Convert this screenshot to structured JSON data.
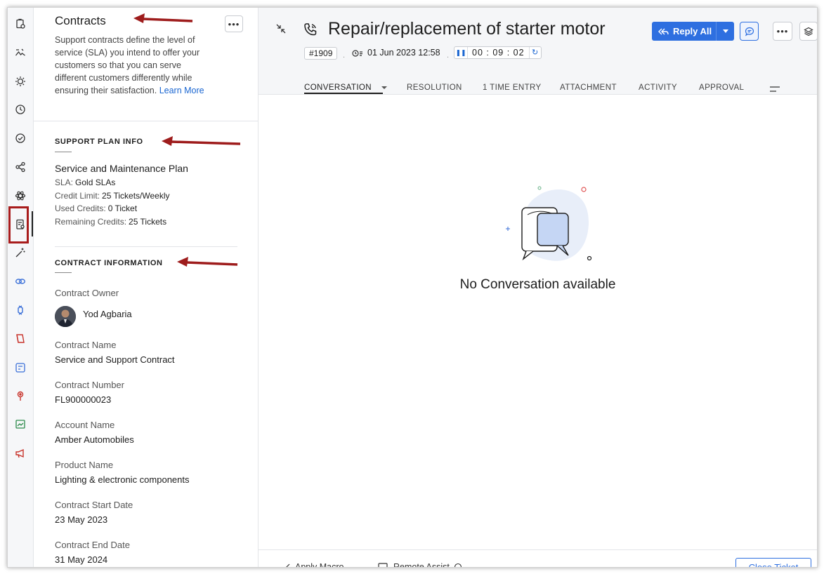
{
  "panel": {
    "title": "Contracts",
    "more_label": "•••",
    "description": "Support contracts define the level of service (SLA) you intend to offer your customers so that you can serve different customers differently while ensuring their satisfaction.",
    "learn_more": "Learn More",
    "support_plan": {
      "heading": "SUPPORT PLAN INFO",
      "plan_name": "Service and Maintenance Plan",
      "sla_label": "SLA:",
      "sla_value": "Gold SLAs",
      "credit_limit_label": "Credit Limit:",
      "credit_limit_value": "25 Tickets/Weekly",
      "used_credits_label": "Used Credits:",
      "used_credits_value": "0 Ticket",
      "remaining_credits_label": "Remaining Credits:",
      "remaining_credits_value": "25 Tickets"
    },
    "contract_info": {
      "heading": "CONTRACT INFORMATION",
      "owner_label": "Contract Owner",
      "owner_name": "Yod Agbaria",
      "name_label": "Contract Name",
      "name_value": "Service and Support Contract",
      "number_label": "Contract Number",
      "number_value": "FL900000023",
      "account_label": "Account Name",
      "account_value": "Amber Automobiles",
      "product_label": "Product Name",
      "product_value": "Lighting & electronic components",
      "start_label": "Contract Start Date",
      "start_value": "23 May 2023",
      "end_label": "Contract End Date",
      "end_value": "31 May 2024"
    }
  },
  "ticket": {
    "title": "Repair/replacement of starter motor",
    "id": "#1909",
    "separator": ".",
    "due_date": "01 Jun 2023 12:58",
    "timer": "00 : 09 : 02",
    "reply_all": "Reply All",
    "more_label": "•••"
  },
  "tabs": [
    {
      "label": "CONVERSATION"
    },
    {
      "label": "RESOLUTION"
    },
    {
      "label": "1 TIME ENTRY"
    },
    {
      "label": "ATTACHMENT"
    },
    {
      "label": "ACTIVITY"
    },
    {
      "label": "APPROVAL"
    }
  ],
  "empty_state": {
    "message": "No Conversation available"
  },
  "footer": {
    "apply_macro": "Apply Macro",
    "remote_assist": "Remote Assist",
    "close_ticket": "Close Ticket"
  },
  "rail_icons": [
    "ticket-clipboard-icon",
    "image-gallery-icon",
    "bulb-icon",
    "history-icon",
    "check-circle-icon",
    "share-icon",
    "atom-icon",
    "contract-icon",
    "magic-wand-icon",
    "link-chain-icon",
    "extension-icon",
    "book-icon",
    "scheduler-icon",
    "location-pin-icon",
    "image-check-icon",
    "megaphone-icon"
  ],
  "colors": {
    "accent": "#2e6fe0",
    "highlight_box": "#a81c1c",
    "annotation_arrow": "#9e1c1c"
  }
}
